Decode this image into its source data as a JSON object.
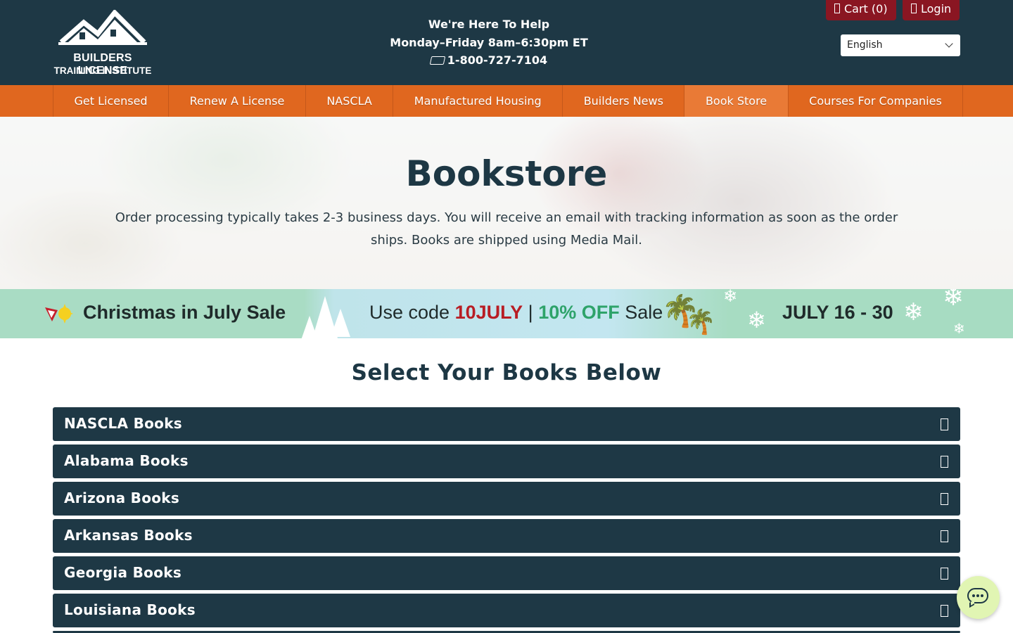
{
  "header": {
    "logo": {
      "line1": "BUILDERS LICENSE",
      "line2": "TRAINING INSTITUTE"
    },
    "help": {
      "title": "We're Here To Help",
      "hours": "Monday–Friday 8am–6:30pm ET",
      "phone": "1-800-727-7104",
      "phone_icon": "phone-icon"
    },
    "cart_label": "Cart (0)",
    "login_label": "Login",
    "language": "English",
    "colors": {
      "header_bg": "#1e3845",
      "button_bg": "#8a1622"
    }
  },
  "nav": {
    "items": [
      {
        "label": "Get Licensed"
      },
      {
        "label": "Renew A License"
      },
      {
        "label": "NASCLA"
      },
      {
        "label": "Manufactured Housing"
      },
      {
        "label": "Builders News"
      },
      {
        "label": "Book Store",
        "active": true
      },
      {
        "label": "Courses For Companies"
      }
    ],
    "color": "#e0671f"
  },
  "hero": {
    "title": "Bookstore",
    "text": "Order processing typically takes 2-3 business days. You will receive an email with tracking information as soon as the order ships. Books are shipped using Media Mail."
  },
  "sale": {
    "left": "Christmas in July Sale",
    "prefix": "Use code ",
    "code": "10JULY",
    "sep": " | ",
    "off": "10% OFF",
    "suffix": " Sale",
    "dates": "JULY 16 - 30"
  },
  "books": {
    "title": "Select Your Books Below",
    "items": [
      {
        "label": "NASCLA Books"
      },
      {
        "label": "Alabama Books"
      },
      {
        "label": "Arizona Books"
      },
      {
        "label": "Arkansas Books"
      },
      {
        "label": "Georgia Books"
      },
      {
        "label": "Louisiana Books"
      }
    ]
  },
  "chat": {
    "icon": "chat-icon"
  }
}
